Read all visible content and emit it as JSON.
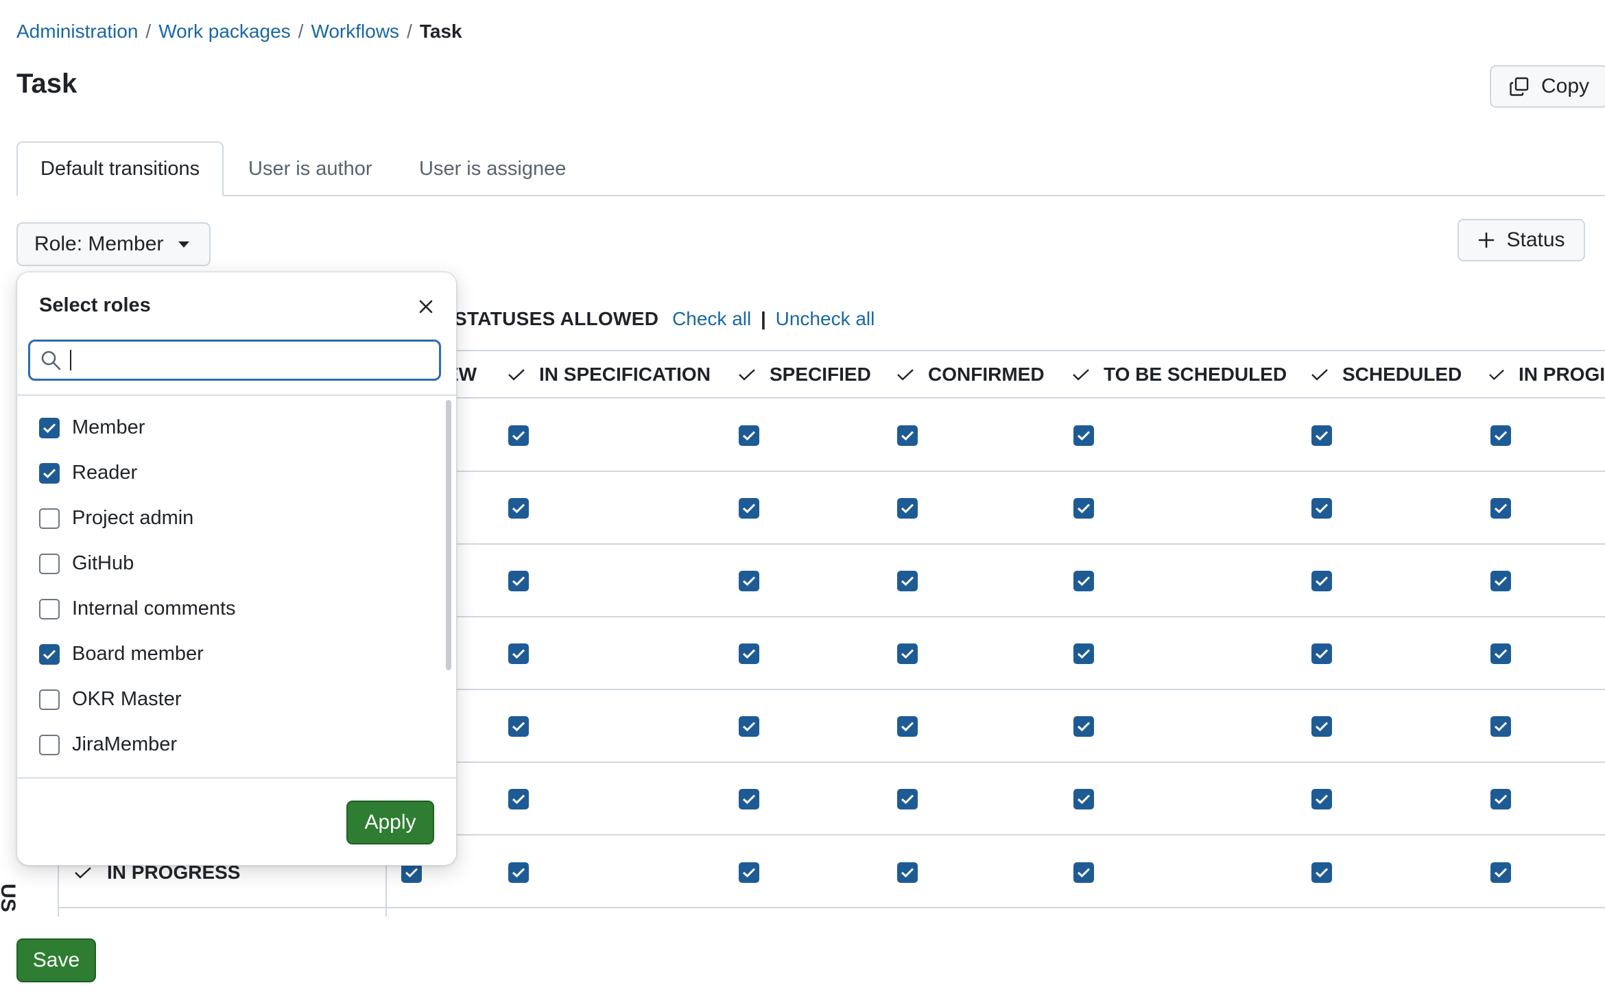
{
  "breadcrumb": {
    "items": [
      "Administration",
      "Work packages",
      "Workflows"
    ],
    "current": "Task"
  },
  "page": {
    "title": "Task"
  },
  "toolbar": {
    "copy_label": "Copy",
    "status_label": "Status"
  },
  "tabs": [
    {
      "label": "Default transitions",
      "active": true
    },
    {
      "label": "User is author",
      "active": false
    },
    {
      "label": "User is assignee",
      "active": false
    }
  ],
  "role_filter": {
    "label": "Role: Member"
  },
  "matrix": {
    "heading": "STATUSES ALLOWED",
    "check_all": "Check all",
    "separator": "|",
    "uncheck_all": "Uncheck all",
    "columns": [
      "EW",
      "IN SPECIFICATION",
      "SPECIFIED",
      "CONFIRMED",
      "TO BE SCHEDULED",
      "SCHEDULED",
      "IN PROGI"
    ],
    "visible_row_label": "IN PROGRESS",
    "side_label": "US"
  },
  "roles_popover": {
    "title": "Select roles",
    "search_value": "",
    "roles": [
      {
        "name": "Member",
        "checked": true
      },
      {
        "name": "Reader",
        "checked": true
      },
      {
        "name": "Project admin",
        "checked": false
      },
      {
        "name": "GitHub",
        "checked": false
      },
      {
        "name": "Internal comments",
        "checked": false
      },
      {
        "name": "Board member",
        "checked": true
      },
      {
        "name": "OKR Master",
        "checked": false
      },
      {
        "name": "JiraMember",
        "checked": false
      }
    ],
    "apply_label": "Apply"
  },
  "footer": {
    "save_label": "Save"
  },
  "colors": {
    "accent": "#1a67a3",
    "checkbox": "#1e5b94",
    "primary_button": "#2e7d32"
  },
  "icons": [
    "copy-icon",
    "plus-icon",
    "chevron-down-icon",
    "close-icon",
    "search-icon",
    "check-icon"
  ]
}
